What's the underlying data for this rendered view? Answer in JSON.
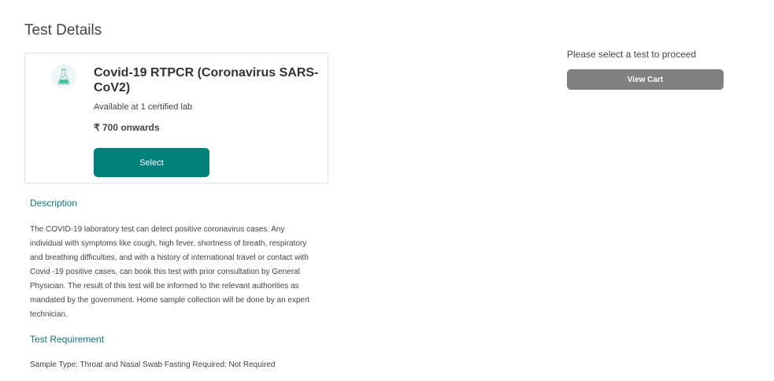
{
  "page": {
    "title": "Test Details"
  },
  "test_card": {
    "icon": "lab-flask-icon",
    "name": "Covid-19 RTPCR (Coronavirus SARS-CoV2)",
    "availability": "Available at 1 certified lab",
    "price": "₹ 700 onwards",
    "select_label": "Select",
    "accent_color": "#00807a"
  },
  "description": {
    "heading": "Description",
    "text": "The COVID-19 laboratory test can detect positive coronavirus cases. Any individual with symptoms like cough, high fever, shortness of breath, respiratory and breathing difficulties, and with a history of international travel or contact with Covid -19 positive cases, can book this test with prior consultation by General Physician. The result of this test will be informed to the relevant authorities as mandated by the government. Home sample collection will be done by an expert technician."
  },
  "requirement": {
    "heading": "Test Requirement",
    "text": "Sample Type: Throat and Nasal Swab Fasting Required: Not Required"
  },
  "cart": {
    "prompt": "Please select a test to proceed",
    "view_cart_label": "View Cart",
    "button_color": "#808080"
  }
}
